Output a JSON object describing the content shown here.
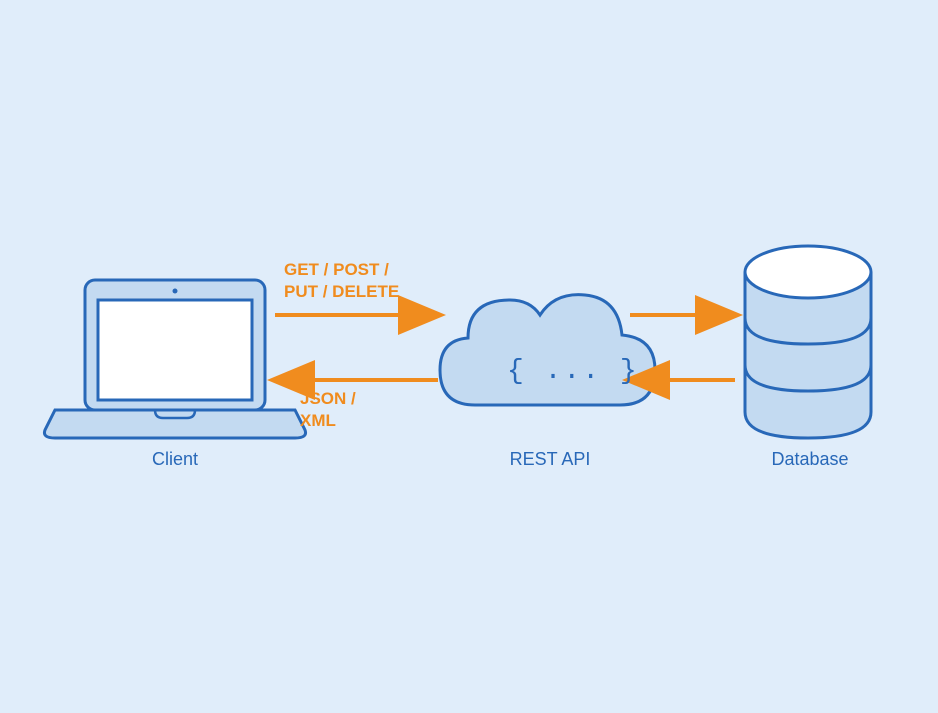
{
  "nodes": {
    "client": {
      "label": "Client"
    },
    "api": {
      "label": "REST API",
      "braces": "{ ... }"
    },
    "database": {
      "label": "Database"
    }
  },
  "arrows": {
    "requestLine1": "GET / POST /",
    "requestLine2": "PUT / DELETE",
    "responseLine1": "JSON /",
    "responseLine2": "XML"
  },
  "colors": {
    "blue": "#2868b8",
    "lightBlue": "#c3daf1",
    "veryLightBlue": "#e0edfa",
    "white": "#ffffff",
    "orange": "#f08c1e"
  }
}
